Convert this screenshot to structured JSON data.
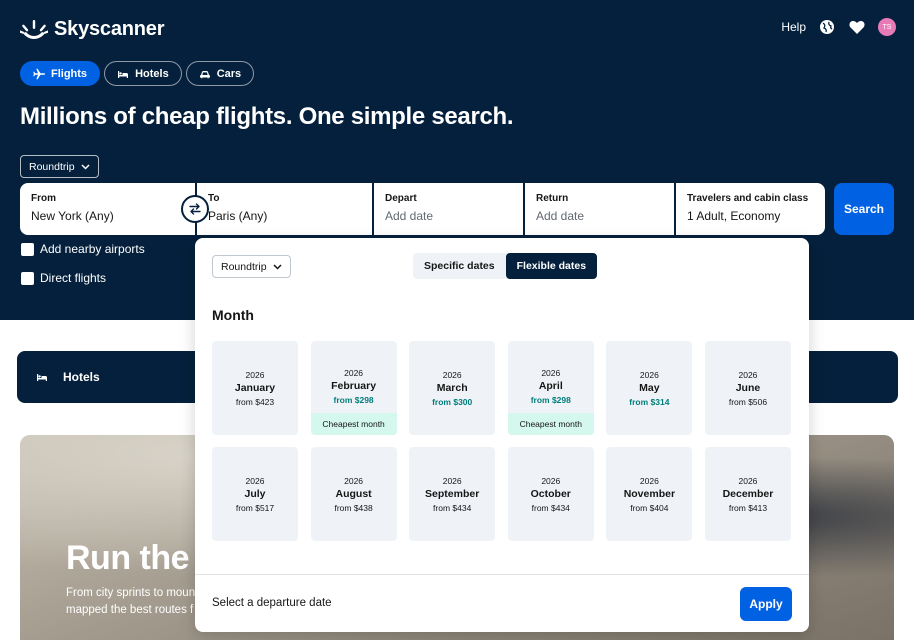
{
  "brand": {
    "name": "Skyscanner"
  },
  "topnav": {
    "help": "Help",
    "avatar_initials": "TS"
  },
  "tabs": [
    {
      "label": "Flights",
      "icon": "plane-icon",
      "active": true
    },
    {
      "label": "Hotels",
      "icon": "bed-icon",
      "active": false
    },
    {
      "label": "Cars",
      "icon": "car-icon",
      "active": false
    }
  ],
  "headline": "Millions of cheap flights. One simple search.",
  "trip_type": "Roundtrip",
  "search": {
    "from": {
      "label": "From",
      "value": "New York (Any)"
    },
    "to": {
      "label": "To",
      "value": "Paris (Any)"
    },
    "depart": {
      "label": "Depart",
      "placeholder": "Add date"
    },
    "return": {
      "label": "Return",
      "placeholder": "Add date"
    },
    "travelers": {
      "label": "Travelers and cabin class",
      "value": "1 Adult, Economy"
    },
    "button": "Search"
  },
  "options": {
    "nearby": "Add nearby airports",
    "direct": "Direct flights"
  },
  "hotels_banner": {
    "label": "Hotels"
  },
  "promo": {
    "title": "Run the W",
    "subtitle": "From city sprints to moun mapped the best routes f"
  },
  "date_picker": {
    "trip_type": "Roundtrip",
    "toggle": {
      "specific": "Specific dates",
      "flexible": "Flexible dates",
      "active": "flexible"
    },
    "heading": "Month",
    "months": [
      {
        "year": "2026",
        "name": "January",
        "price": "from $423",
        "cheap": false,
        "caption": ""
      },
      {
        "year": "2026",
        "name": "February",
        "price": "from $298",
        "cheap": true,
        "caption": "Cheapest month"
      },
      {
        "year": "2026",
        "name": "March",
        "price": "from $300",
        "cheap": true,
        "caption": ""
      },
      {
        "year": "2026",
        "name": "April",
        "price": "from $298",
        "cheap": true,
        "caption": "Cheapest month"
      },
      {
        "year": "2026",
        "name": "May",
        "price": "from $314",
        "cheap": true,
        "caption": ""
      },
      {
        "year": "2026",
        "name": "June",
        "price": "from $506",
        "cheap": false,
        "caption": ""
      },
      {
        "year": "2026",
        "name": "July",
        "price": "from $517",
        "cheap": false,
        "caption": ""
      },
      {
        "year": "2026",
        "name": "August",
        "price": "from $438",
        "cheap": false,
        "caption": ""
      },
      {
        "year": "2026",
        "name": "September",
        "price": "from $434",
        "cheap": false,
        "caption": ""
      },
      {
        "year": "2026",
        "name": "October",
        "price": "from $434",
        "cheap": false,
        "caption": ""
      },
      {
        "year": "2026",
        "name": "November",
        "price": "from $404",
        "cheap": false,
        "caption": ""
      },
      {
        "year": "2026",
        "name": "December",
        "price": "from $413",
        "cheap": false,
        "caption": ""
      }
    ],
    "footer_text": "Select a departure date",
    "apply": "Apply"
  },
  "colors": {
    "navy": "#05203c",
    "blue": "#0062e3",
    "cheap_green": "#007d7a",
    "cheap_bg": "#d4f7ee"
  }
}
